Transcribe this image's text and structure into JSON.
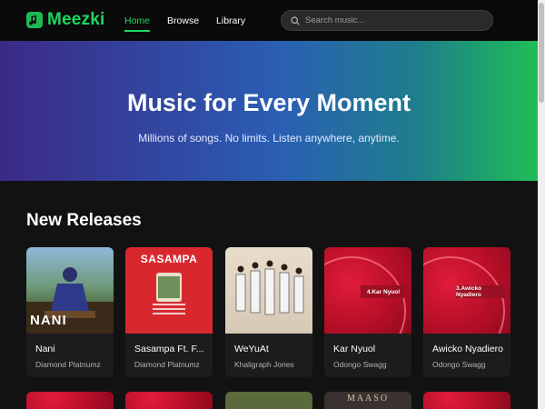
{
  "brand": {
    "name": "Meezki",
    "accent": "#1ed760"
  },
  "nav": {
    "items": [
      {
        "label": "Home",
        "active": true
      },
      {
        "label": "Browse",
        "active": false
      },
      {
        "label": "Library",
        "active": false
      }
    ]
  },
  "search": {
    "placeholder": "Search music..."
  },
  "hero": {
    "title": "Music for Every Moment",
    "subtitle": "Millions of songs. No limits. Listen anywhere, anytime."
  },
  "new_releases": {
    "title": "New Releases",
    "cards": [
      {
        "title": "Nani",
        "artist": "Diamond Platnumz",
        "cover_text": "NANI"
      },
      {
        "title": "Sasampa Ft. F...",
        "artist": "Diamond Platnumz",
        "cover_text": "SASAMPA"
      },
      {
        "title": "WeYuAt",
        "artist": "Khaligraph Jones",
        "cover_text": ""
      },
      {
        "title": "Kar Nyuol",
        "artist": "Odongo Swagg",
        "cover_text": "4.Kar Nyuol"
      },
      {
        "title": "Awicko Nyadiero",
        "artist": "Odongo Swagg",
        "cover_text": "3.Awicko Nyadiero"
      }
    ]
  },
  "row2_covers": [
    "",
    "",
    "",
    "MAASO",
    ""
  ]
}
